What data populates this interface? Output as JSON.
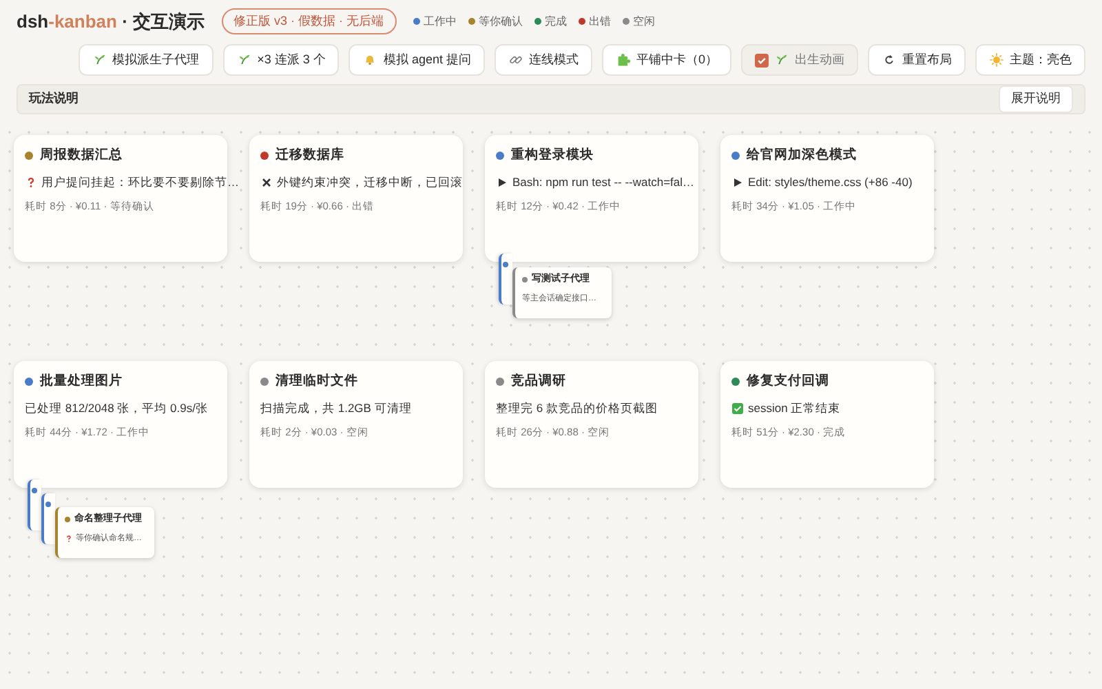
{
  "header": {
    "brand_main": "dsh",
    "brand_accent": "-kanban",
    "brand_suffix": " · 交互演示",
    "version_badge": "修正版 v3 · 假数据 · 无后端"
  },
  "legend": [
    {
      "label": "工作中",
      "color": "#4a7cc7"
    },
    {
      "label": "等你确认",
      "color": "#a8832e"
    },
    {
      "label": "完成",
      "color": "#2e8b57"
    },
    {
      "label": "出错",
      "color": "#c0392b"
    },
    {
      "label": "空闲",
      "color": "#8a8a8a"
    }
  ],
  "toolbar": [
    {
      "kind": "sprout",
      "label": "模拟派生子代理"
    },
    {
      "kind": "sprout",
      "label": "×3 连派 3 个"
    },
    {
      "kind": "bell",
      "label": "模拟 agent 提问"
    },
    {
      "kind": "link",
      "label": "连线模式"
    },
    {
      "kind": "puzzle",
      "label": "平铺中卡（0）"
    },
    {
      "kind": "toggle",
      "label": "出生动画",
      "checked": true
    },
    {
      "kind": "reset",
      "label": "重置布局"
    },
    {
      "kind": "sun",
      "label": "主题：亮色"
    }
  ],
  "help_panel": {
    "title": "玩法说明",
    "button": "展开说明"
  },
  "cards": [
    {
      "title": "周报数据汇总",
      "color": "#a8832e",
      "kind": "question",
      "body": "用户提问挂起：环比要不要剔除节…",
      "meta": "耗时 8分 · ¥0.11 · 等待确认"
    },
    {
      "title": "迁移数据库",
      "color": "#c0392b",
      "kind": "cross",
      "body": "外键约束冲突，迁移中断，已回滚",
      "meta": "耗时 19分 · ¥0.66 · 出错"
    },
    {
      "title": "重构登录模块",
      "color": "#4a7cc7",
      "kind": "play",
      "body": "Bash: npm run test -- --watch=fal…",
      "meta": "耗时 12分 · ¥0.42 · 工作中",
      "subagents": [
        {
          "color": "#4a7cc7"
        },
        {
          "color": "#8a8a8a",
          "title": "写测试子代理",
          "body": "等主会话确定接口…"
        }
      ]
    },
    {
      "title": "给官网加深色模式",
      "color": "#4a7cc7",
      "kind": "play",
      "body": "Edit: styles/theme.css (+86 -40)",
      "meta": "耗时 34分 · ¥1.05 · 工作中"
    },
    {
      "title": "批量处理图片",
      "color": "#4a7cc7",
      "kind": "plain",
      "body": "已处理 812/2048 张，平均 0.9s/张",
      "meta": "耗时 44分 · ¥1.72 · 工作中",
      "subagents": [
        {
          "color": "#4a7cc7"
        },
        {
          "color": "#4a7cc7"
        },
        {
          "color": "#a8832e",
          "title": "命名整理子代理",
          "kind": "question",
          "body": "等你确认命名规…"
        }
      ]
    },
    {
      "title": "清理临时文件",
      "color": "#8a8a8a",
      "kind": "plain",
      "body": "扫描完成，共 1.2GB 可清理",
      "meta": "耗时 2分 · ¥0.03 · 空闲"
    },
    {
      "title": "竞品调研",
      "color": "#8a8a8a",
      "kind": "plain",
      "body": "整理完 6 款竞品的价格页截图",
      "meta": "耗时 26分 · ¥0.88 · 空闲"
    },
    {
      "title": "修复支付回调",
      "color": "#2e8b57",
      "kind": "check",
      "body": "session 正常结束",
      "meta": "耗时 51分 · ¥2.30 · 完成"
    }
  ]
}
